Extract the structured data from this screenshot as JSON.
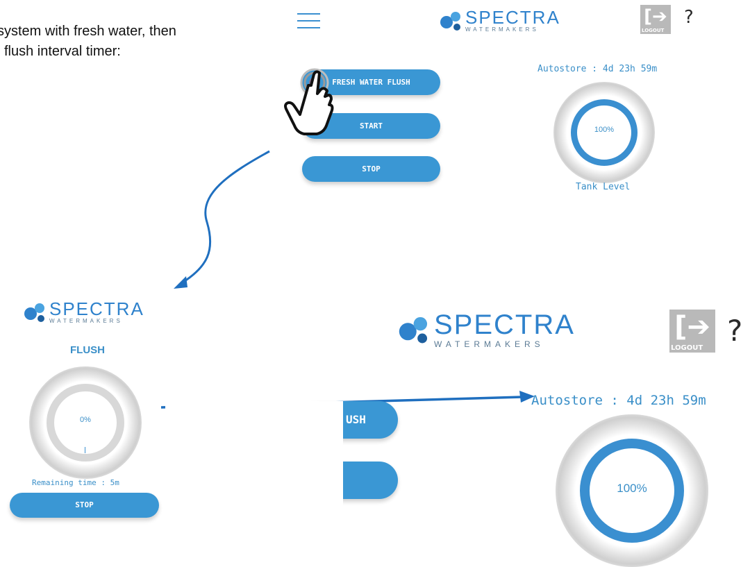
{
  "instructions": {
    "line1": "system with fresh water, then",
    "line2": "flush interval timer:"
  },
  "header": {
    "brand": "SPECTRA",
    "brand_sub": "WATERMAKERS",
    "logout_label": "LOGOUT",
    "help_label": "?"
  },
  "top_panel": {
    "buttons": [
      "FRESH WATER FLUSH",
      "START",
      "STOP"
    ],
    "autostore": "Autostore : 4d 23h 59m",
    "tank_percent": "100%",
    "tank_label": "Tank Level"
  },
  "flush_panel": {
    "title": "FLUSH",
    "percent": "0%",
    "remaining": "Remaining time : 5m",
    "stop_label": "STOP"
  },
  "zoom_panel": {
    "autostore": "Autostore : 4d 23h 59m",
    "button_partial": "USH",
    "tank_percent": "100%"
  },
  "colors": {
    "accent": "#3a97d4",
    "arrow": "#1f6fbf",
    "logout_bg": "#b9b9b9"
  }
}
